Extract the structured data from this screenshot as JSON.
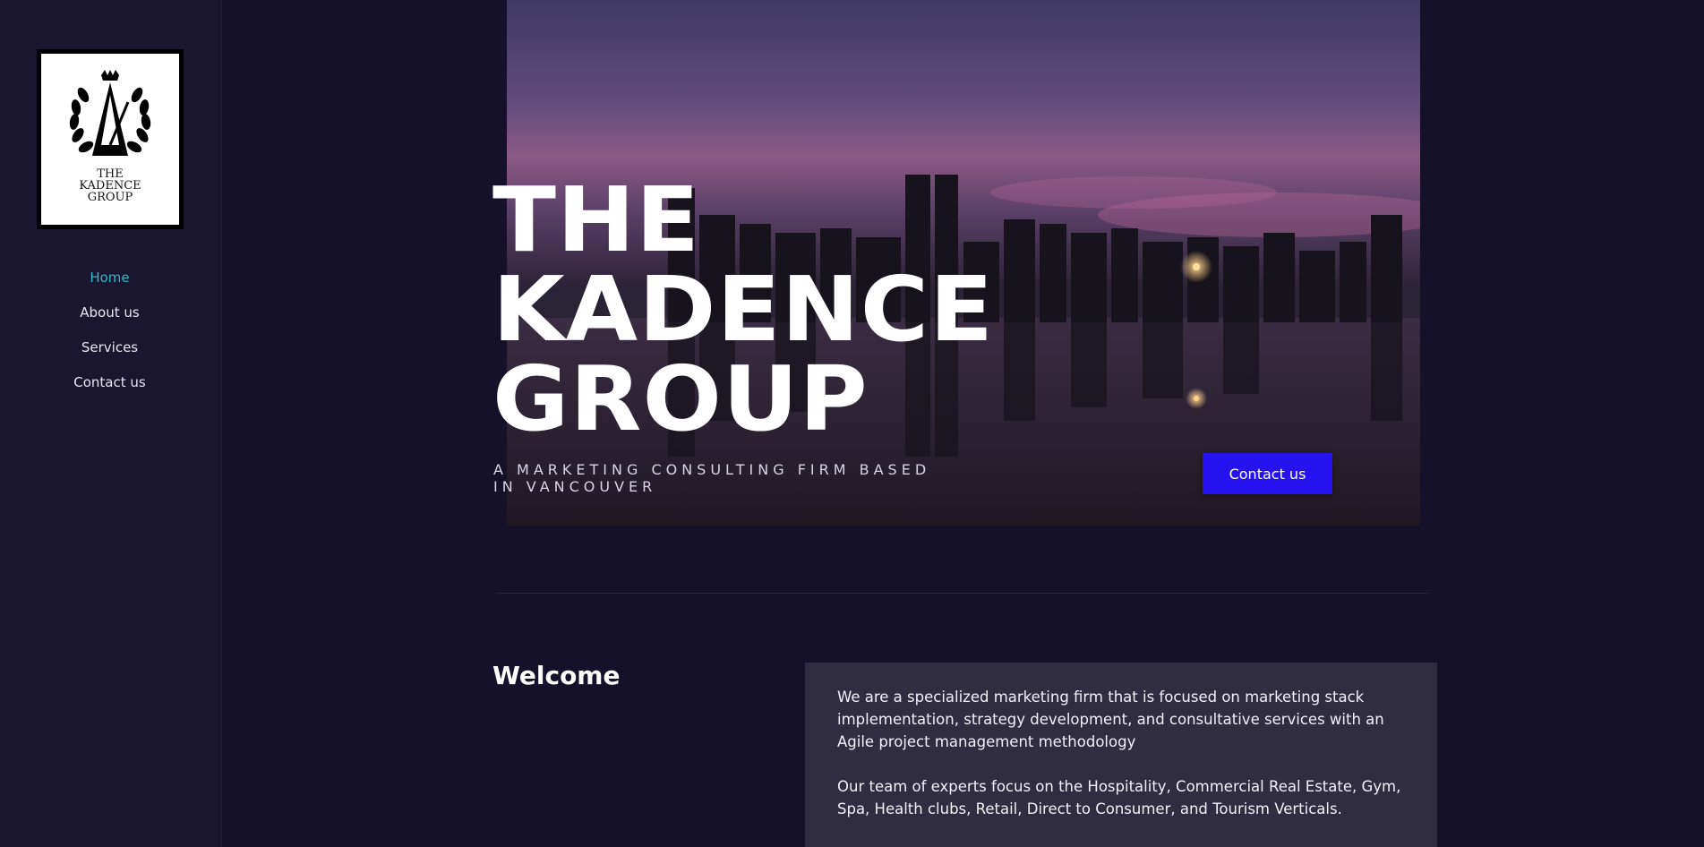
{
  "logo": {
    "text": "THE\nKADENCE\nGROUP"
  },
  "nav": {
    "items": [
      {
        "label": "Home",
        "active": true
      },
      {
        "label": "About us"
      },
      {
        "label": "Services"
      },
      {
        "label": "Contact us"
      }
    ]
  },
  "hero": {
    "title": "THE\nKADENCE\nGROUP",
    "subtitle": "A MARKETING CONSULTING FIRM BASED IN VANCOUVER",
    "cta": "Contact us"
  },
  "welcome": {
    "title": "Welcome",
    "paragraphs": [
      "We are a specialized marketing firm that is focused on marketing stack implementation, strategy development, and consultative services with an Agile project management methodology",
      "Our team of experts focus on the Hospitality, Commercial Real Estate, Gym, Spa, Health clubs, Retail, Direct to Consumer, and Tourism Verticals."
    ]
  },
  "colors": {
    "accent": "#2fb9c4",
    "button": "#2412ef",
    "background": "#15112a"
  },
  "icons": {
    "logo": "metronome-laurel-crown-logo"
  }
}
